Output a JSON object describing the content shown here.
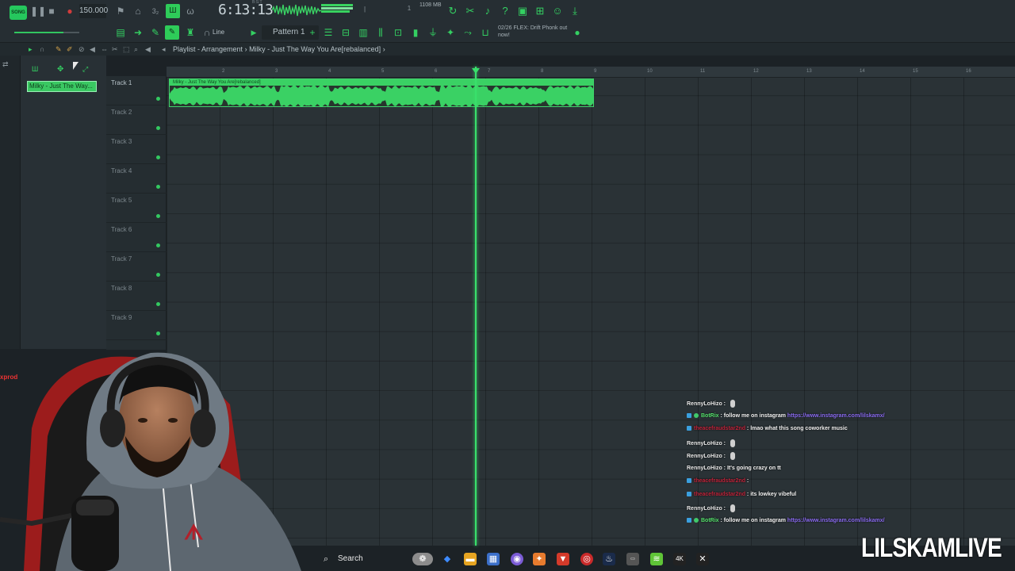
{
  "toolbar": {
    "mode_badge": "SONG",
    "tempo": "150.000",
    "time": "6:13:13",
    "time_unit": "B:S:T",
    "memory": "1108 MB",
    "pattern": "Pattern 1",
    "snap_mode": "Line",
    "news_date": "02/26",
    "news_text": "FLEX: Drift Phonk out now!"
  },
  "playlist": {
    "title": "Playlist - Arrangement",
    "separator": "›",
    "song_name": "Milky - Just The Way You Are[rebalanced]",
    "end_arrow": "›",
    "picker_clip": "Milky - Just The Way...",
    "clip_label": "Milky - Just The Way You Are[rebalanced]",
    "tracks": [
      "Track 1",
      "Track 2",
      "Track 3",
      "Track 4",
      "Track 5",
      "Track 6",
      "Track 7",
      "Track 8",
      "Track 9"
    ],
    "ruler": [
      "2",
      "3",
      "4",
      "5",
      "6",
      "7",
      "8",
      "9",
      "10",
      "11",
      "12",
      "13",
      "14",
      "15",
      "16"
    ]
  },
  "chat": [
    {
      "user": "RennyLoHizo",
      "user_style": "plain",
      "sep": " : ",
      "text": "",
      "link": "",
      "mic": true
    },
    {
      "user": "BotRix",
      "user_style": "green",
      "sep": " : ",
      "text": "follow me on instagram ",
      "link": "https://www.instagram.com/lilskamx/",
      "mic": false
    },
    {
      "user": "theacefraudstar2nd",
      "user_style": "red",
      "sep": " : ",
      "text": "lmao what this song coworker music",
      "link": "",
      "mic": false
    },
    {
      "user": "RennyLoHizo",
      "user_style": "plain",
      "sep": " : ",
      "text": "",
      "link": "",
      "mic": true
    },
    {
      "user": "RennyLoHizo",
      "user_style": "plain",
      "sep": " : ",
      "text": "",
      "link": "",
      "mic": true
    },
    {
      "user": "RennyLoHizo",
      "user_style": "plain",
      "sep": " : ",
      "text": "It's going crazy on tt",
      "link": "",
      "mic": false
    },
    {
      "user": "theacefraudstar2nd",
      "user_style": "red",
      "sep": " : ",
      "text": "",
      "link": "",
      "mic": false
    },
    {
      "user": "theacefraudstar2nd",
      "user_style": "red",
      "sep": " : ",
      "text": "its lowkey vibeful",
      "link": "",
      "mic": false
    },
    {
      "user": "RennyLoHizo",
      "user_style": "plain",
      "sep": " : ",
      "text": "",
      "link": "",
      "mic": true
    },
    {
      "user": "BotRix",
      "user_style": "green",
      "sep": " : ",
      "text": "follow me on instagram ",
      "link": "https://www.instagram.com/lilskamx/",
      "mic": false
    }
  ],
  "taskbar": {
    "search_label": "Search"
  },
  "side_label": "xprod",
  "watermark": "LILSKAMLIVE",
  "colors": {
    "accent": "#39e06b",
    "background": "#2a3236",
    "chat_link": "#8b6cf2",
    "chat_red": "#c0233a"
  }
}
